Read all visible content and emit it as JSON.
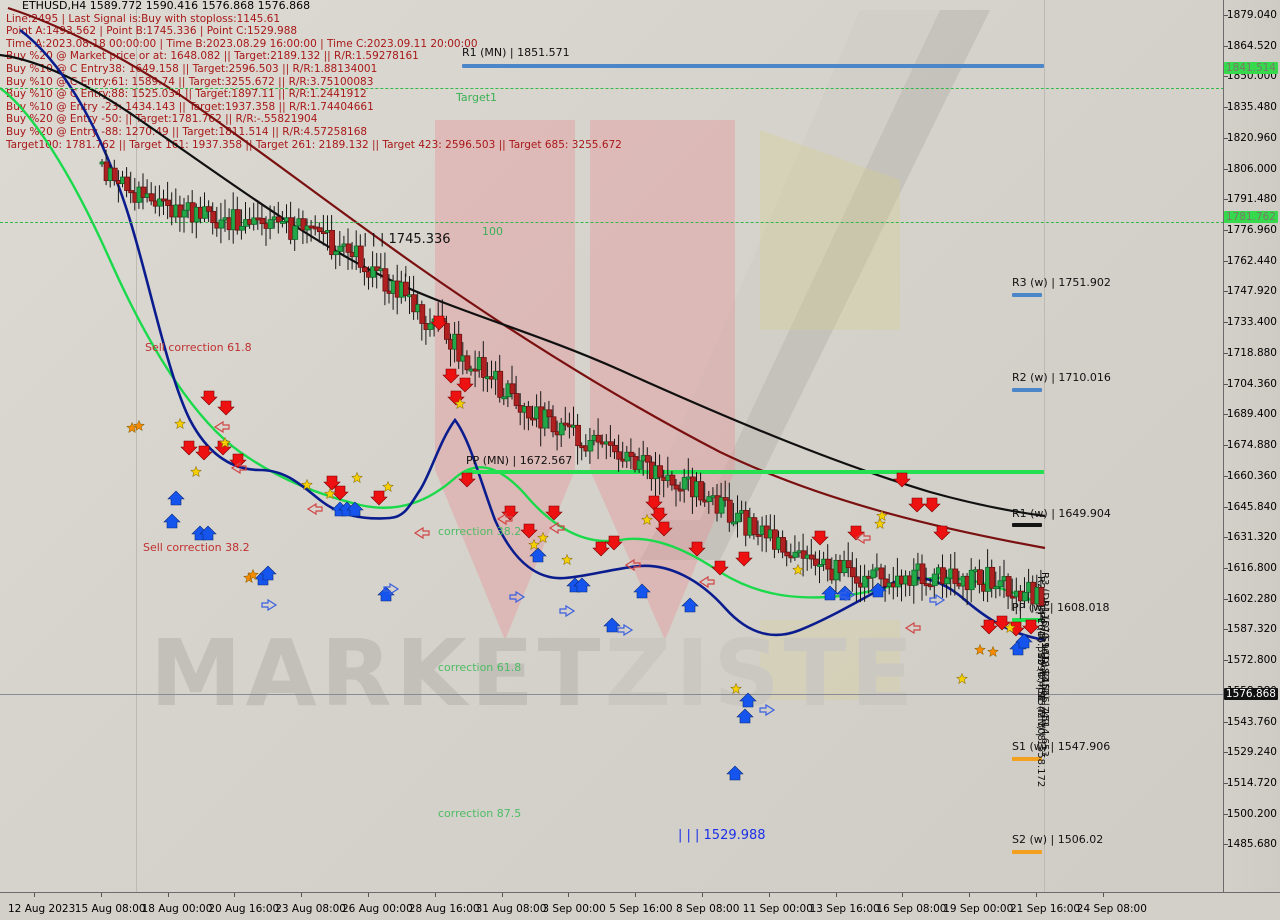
{
  "chart_data": {
    "type": "line",
    "title": "ETHUSD,H4  1589.772 1590.416 1576.868 1576.868",
    "symbol": "ETHUSD",
    "timeframe": "H4",
    "ohlc": {
      "open": "1589.772",
      "high": "1590.416",
      "low": "1576.868",
      "close": "1576.868"
    },
    "ylabel": "",
    "xlabel": "",
    "ylim": [
      1485.68,
      1879.04
    ],
    "grid": true,
    "legend": "none",
    "y_ticks": [
      "1879.040",
      "1864.520",
      "1850.000",
      "1835.480",
      "1820.960",
      "1806.000",
      "1791.480",
      "1776.960",
      "1762.440",
      "1747.920",
      "1733.400",
      "1718.880",
      "1704.360",
      "1689.400",
      "1674.880",
      "1660.360",
      "1645.840",
      "1631.320",
      "1616.800",
      "1602.280",
      "1587.320",
      "1572.800",
      "1558.280",
      "1543.760",
      "1529.240",
      "1514.720",
      "1500.200",
      "1485.680"
    ],
    "y_highlights": [
      {
        "value": "1841.514",
        "style": "green"
      },
      {
        "value": "1781.762",
        "style": "green"
      },
      {
        "value": "1576.868",
        "style": "black"
      }
    ],
    "x_ticks": [
      "12 Aug 2023",
      "15 Aug 08:00",
      "18 Aug 00:00",
      "20 Aug 16:00",
      "23 Aug 08:00",
      "26 Aug 00:00",
      "28 Aug 16:00",
      "31 Aug 08:00",
      "3 Sep 00:00",
      "5 Sep 16:00",
      "8 Sep 08:00",
      "11 Sep 00:00",
      "13 Sep 16:00",
      "16 Sep 08:00",
      "19 Sep 00:00",
      "21 Sep 16:00",
      "24 Sep 08:00"
    ]
  },
  "header": {
    "symbol_line": "ETHUSD,H4  1589.772 1590.416 1576.868 1576.868",
    "lines": [
      "Line:2495 | Last Signal is:Buy with stoploss:1145.61",
      "Point A:1493.562 |  Point B:1745.336 |  Point C:1529.988",
      "Time A:2023.08.18 00:00:00 | Time B:2023.08.29 16:00:00 | Time C:2023.09.11 20:00:00",
      "Buy %20 @ Market price or at: 1648.082 || Target:2189.132 || R/R:1.59278161",
      "Buy %10 @ C  Entry38: 1649.158 || Target:2596.503 || R/R:1.88134001",
      "Buy %10 @ C  Entry:61: 1589.74 || Target:3255.672 || R/R:3.75100083",
      "Buy %10 @ C  Entry:88: 1525.034 || Target:1897.11 || R/R:1.2441912",
      "Buy %10 @ Entry -23: 1434.143 || Target:1937.358 || R/R:1.74404661",
      "Buy %20 @ Entry -50:  || Target:1781.762 || R/R:-.55821904",
      "Buy %20 @ Entry -88: 1270.49 || Target:1811.514 || R/R:4.57258168",
      "Target100: 1781.762 || Target 161: 1937.358 || Target 261: 2189.132 || Target 423: 2596.503 || Target 685: 3255.672"
    ]
  },
  "levels": [
    {
      "name": "R1 (MN)",
      "value": "1851.571",
      "color": "#4a86c8",
      "label": "R1 (MN) | 1851.571"
    },
    {
      "name": "R3 (w)",
      "value": "1751.902",
      "color": "#4a86c8",
      "label": "R3 (w) | 1751.902"
    },
    {
      "name": "R2 (w)",
      "value": "1710.016",
      "color": "#4a86c8",
      "label": "R2 (w) | 1710.016"
    },
    {
      "name": "PP (MN)",
      "value": "1672.567",
      "color": "#22e04f",
      "label": "PP (MN) | 1672.567"
    },
    {
      "name": "R1 (w)",
      "value": "1649.904",
      "color": "#151515",
      "label": "R1 (w) | 1649.904"
    },
    {
      "name": "PP (w)",
      "value": "1608.018",
      "color": "#22e04f",
      "label": "PP (w) | 1608.018"
    },
    {
      "name": "S1 (w)",
      "value": "1547.906",
      "color": "#f2a01e",
      "label": "S1 (w) | 1547.906"
    },
    {
      "name": "S2 (w)",
      "value": "1506.02",
      "color": "#f2a01e",
      "label": "S2 (w) | 1506.02"
    }
  ],
  "fib_lines": [
    {
      "label": "Target1",
      "color": "#35b84a"
    },
    {
      "label": "100",
      "color": "#35b84a"
    }
  ],
  "annotations": [
    {
      "text": "Sell correction 61.8",
      "color": "red"
    },
    {
      "text": "Sell correction 38.2",
      "color": "red"
    },
    {
      "text": "correction 38.2",
      "color": "green"
    },
    {
      "text": "correction 61.8",
      "color": "green"
    },
    {
      "text": "correction 87.5",
      "color": "green"
    },
    {
      "text": "| | | 1745.336",
      "color": "black"
    },
    {
      "text": "| | | 1529.988",
      "color": "blue"
    }
  ],
  "vertical_labels": [
    "R3 (D) | 1670.941",
    "R2 (D) | 1646.500",
    "R1 (D) | 1618.845",
    "PP (D) | 1594.404",
    "S1 (D) | 1566.749",
    "S2 (D) | 1542.308",
    "S3 (D) | 1514.653",
    "S1 (MN) | 1558.172"
  ],
  "watermark": {
    "bold": "MARKET",
    "light": "ZISTE"
  }
}
